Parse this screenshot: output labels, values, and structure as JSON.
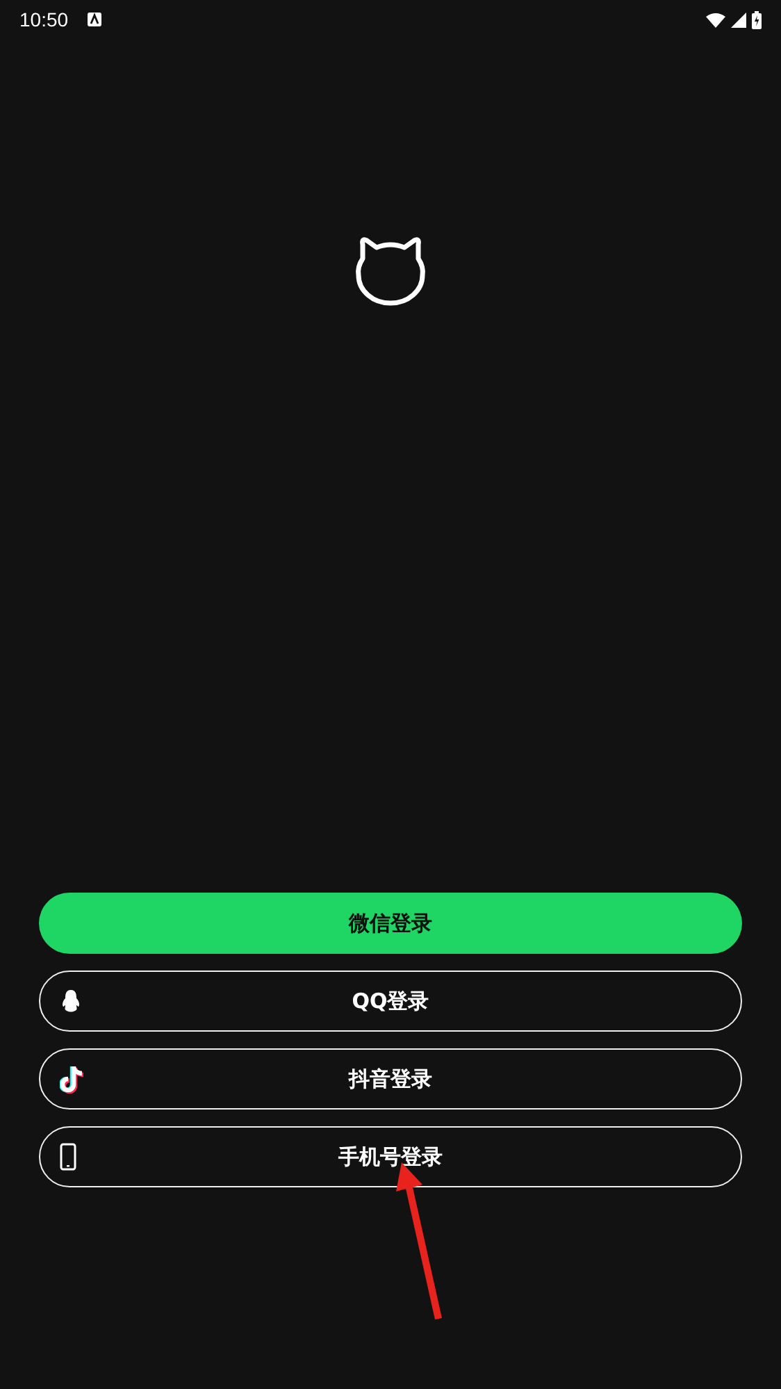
{
  "status_bar": {
    "time": "10:50"
  },
  "buttons": [
    {
      "label": "微信登录",
      "kind": "wechat"
    },
    {
      "label": "QQ登录",
      "kind": "qq"
    },
    {
      "label": "抖音登录",
      "kind": "douyin"
    },
    {
      "label": "手机号登录",
      "kind": "phone"
    }
  ],
  "annotation": {
    "kind": "arrow"
  }
}
